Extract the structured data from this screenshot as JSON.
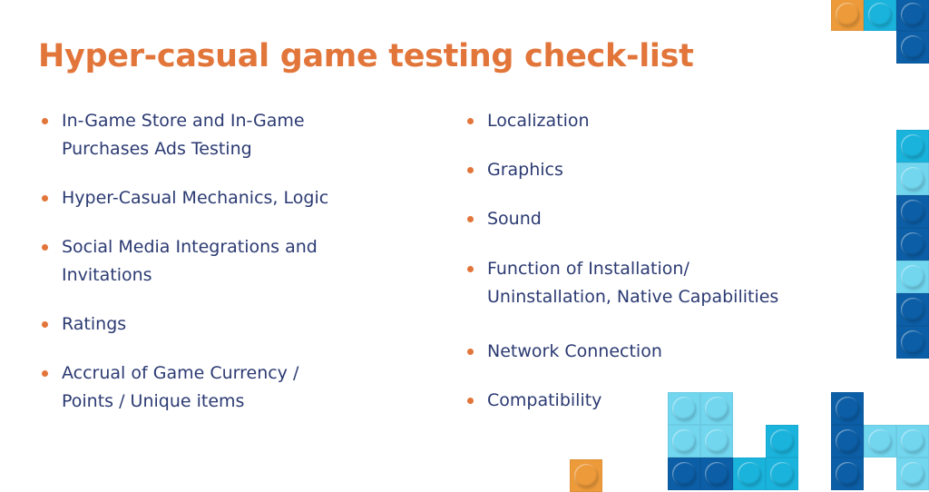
{
  "title": "Hyper-casual game testing check-list",
  "left_column": [
    {
      "lines": [
        "In-Game Store and In-Game",
        "Purchases Ads Testing"
      ]
    },
    {
      "lines": [
        "Hyper-Casual Mechanics, Logic"
      ]
    },
    {
      "lines": [
        "Social Media Integrations and",
        "Invitations"
      ]
    },
    {
      "lines": [
        "Ratings"
      ]
    },
    {
      "lines": [
        "Accrual of Game Currency /",
        "Points / Unique items"
      ]
    }
  ],
  "right_column": [
    {
      "lines": [
        "Localization"
      ]
    },
    {
      "lines": [
        "Graphics"
      ]
    },
    {
      "lines": [
        "Sound"
      ]
    },
    {
      "lines": [
        "Function of Installation/",
        "Uninstallation, Native Capabilities"
      ]
    },
    {
      "lines": [
        "Network Connection"
      ]
    },
    {
      "lines": [
        "Compatibility"
      ]
    }
  ],
  "colors": {
    "title": "#e2753a",
    "text": "#2b3a72",
    "bullet": "#e2753a",
    "brick_orange": "#ec9a3a",
    "brick_cyan": "#1ab3dc",
    "brick_light": "#72d6ef",
    "brick_dark": "#0c5ea6"
  },
  "decoration": {
    "icon": "lego-brick-icon"
  }
}
